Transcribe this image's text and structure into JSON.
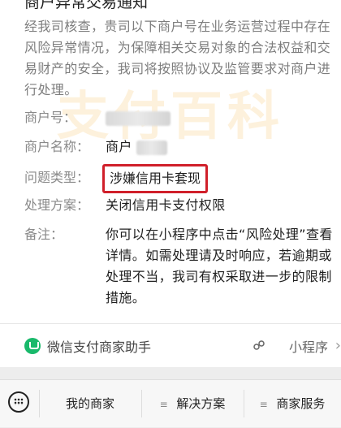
{
  "card": {
    "title": "商户异常交易通知",
    "intro": "经我司核查，贵司以下商户号在业务运营过程中存在风险异常情况，为保障相关交易对象的合法权益和交易财产的安全，我司将按照协议及监管要求对商户进行处理。",
    "watermark": "支付百科",
    "rows": [
      {
        "label": "商户号：",
        "value": ""
      },
      {
        "label": "商户名称：",
        "value": "商户"
      },
      {
        "label": "问题类型：",
        "value": "涉嫌信用卡套现"
      },
      {
        "label": "处理方案：",
        "value": "关闭信用卡支付权限"
      },
      {
        "label": "备注：",
        "value": "你可以在小程序中点击“风险处理”查看详情。如需处理请及时响应，若逾期或处理不当，我司有权采取进一步的限制措施。"
      }
    ],
    "highlight_color": "#d01f2a"
  },
  "source": {
    "name": "微信支付商家助手",
    "mini_program": "小程序"
  },
  "bottom_bar": {
    "tabs": [
      "我的商家",
      "解决方案",
      "商家服务"
    ]
  }
}
